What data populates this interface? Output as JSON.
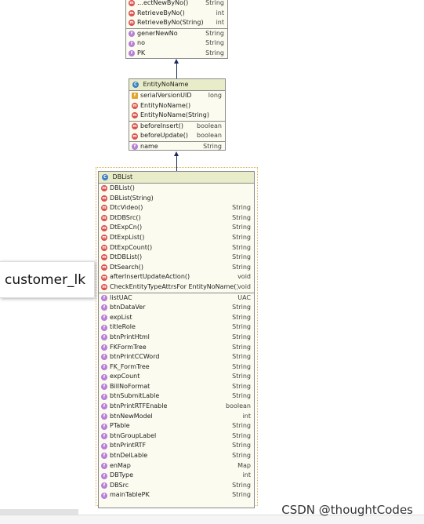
{
  "top_class": {
    "methods": [
      {
        "vis": "",
        "name": "…ectNewByNo()",
        "type": "String",
        "icon": "m"
      },
      {
        "vis": "",
        "name": "RetrieveByNo()",
        "type": "int",
        "icon": "m"
      },
      {
        "vis": "",
        "name": "RetrieveByNo(String)",
        "type": "int",
        "icon": "m"
      }
    ],
    "fields": [
      {
        "vis": "",
        "name": "generNewNo",
        "type": "String",
        "icon": "f"
      },
      {
        "vis": "",
        "name": "no",
        "type": "String",
        "icon": "f"
      },
      {
        "vis": "",
        "name": "PK",
        "type": "String",
        "icon": "f"
      }
    ]
  },
  "entity_no_name": {
    "title": "EntityNoName",
    "members": [
      {
        "vis": "",
        "name": "serialVersionUID",
        "type": "long",
        "icon": "s"
      },
      {
        "vis": "",
        "name": "EntityNoName()",
        "type": "",
        "icon": "m"
      },
      {
        "vis": "",
        "name": "EntityNoName(String)",
        "type": "",
        "icon": "m"
      }
    ],
    "methods": [
      {
        "vis": "",
        "name": "beforeInsert()",
        "type": "boolean",
        "icon": "m"
      },
      {
        "vis": "",
        "name": "beforeUpdate()",
        "type": "boolean",
        "icon": "m"
      }
    ],
    "fields": [
      {
        "vis": "",
        "name": "name",
        "type": "String",
        "icon": "f"
      }
    ]
  },
  "dblist": {
    "title": "DBList",
    "methods": [
      {
        "vis": "",
        "name": "DBList()",
        "type": "",
        "icon": "m"
      },
      {
        "vis": "",
        "name": "DBList(String)",
        "type": "",
        "icon": "m"
      },
      {
        "vis": "",
        "name": "DtcVideo()",
        "type": "String",
        "icon": "m"
      },
      {
        "vis": "",
        "name": "DtDBSrc()",
        "type": "String",
        "icon": "m"
      },
      {
        "vis": "",
        "name": "DtExpCn()",
        "type": "String",
        "icon": "m"
      },
      {
        "vis": "",
        "name": "DtExpList()",
        "type": "String",
        "icon": "m"
      },
      {
        "vis": "",
        "name": "DtExpCount()",
        "type": "String",
        "icon": "m"
      },
      {
        "vis": "",
        "name": "DtDBList()",
        "type": "String",
        "icon": "m"
      },
      {
        "vis": "",
        "name": "DtSearch()",
        "type": "String",
        "icon": "m"
      },
      {
        "vis": "",
        "name": "afterInsertUpdateAction()",
        "type": "void",
        "icon": "m"
      },
      {
        "vis": "",
        "name": "CheckEntityTypeAttrsFor EntityNoName()",
        "type": "void",
        "icon": "m"
      }
    ],
    "fields": [
      {
        "name": "listUAC",
        "type": "UAC"
      },
      {
        "name": "btnDataVer",
        "type": "String"
      },
      {
        "name": "expList",
        "type": "String"
      },
      {
        "name": "titleRole",
        "type": "String"
      },
      {
        "name": "btnPrintHtml",
        "type": "String"
      },
      {
        "name": "FKFormTree",
        "type": "String"
      },
      {
        "name": "btnPrintCCWord",
        "type": "String"
      },
      {
        "name": "FK_FormTree",
        "type": "String"
      },
      {
        "name": "expCount",
        "type": "String"
      },
      {
        "name": "BillNoFormat",
        "type": "String"
      },
      {
        "name": "btnSubmitLable",
        "type": "String"
      },
      {
        "name": "btnPrintRTFEnable",
        "type": "boolean"
      },
      {
        "name": "btnNewModel",
        "type": "int"
      },
      {
        "name": "PTable",
        "type": "String"
      },
      {
        "name": "btnGroupLabel",
        "type": "String"
      },
      {
        "name": "btnPrintRTF",
        "type": "String"
      },
      {
        "name": "btnDelLable",
        "type": "String"
      },
      {
        "name": "enMap",
        "type": "Map"
      },
      {
        "name": "DBType",
        "type": "int"
      },
      {
        "name": "DBSrc",
        "type": "String"
      },
      {
        "name": "mainTablePK",
        "type": "String"
      }
    ]
  },
  "tooltip_text": "customer_lk",
  "watermark": "CSDN @thoughtCodes",
  "colors": {
    "header": "#e9ecc8",
    "body": "#fbfbef",
    "connector": "#1a2a5a"
  }
}
